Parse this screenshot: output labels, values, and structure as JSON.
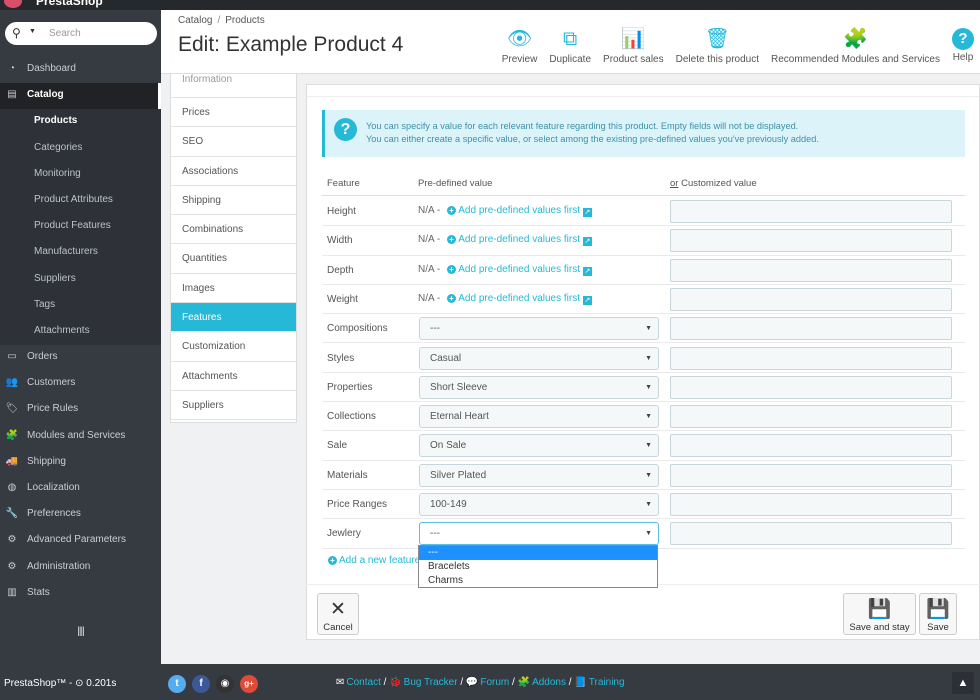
{
  "topbar": {
    "brand": "PrestaShop"
  },
  "sidebar": {
    "search_placeholder": "Search",
    "items": [
      {
        "label": "Dashboard",
        "icon": "dashboard-icon"
      },
      {
        "label": "Catalog",
        "icon": "catalog-icon",
        "active": true
      },
      {
        "label": "Products",
        "sub": true,
        "current": true
      },
      {
        "label": "Categories",
        "sub": true
      },
      {
        "label": "Monitoring",
        "sub": true
      },
      {
        "label": "Product Attributes",
        "sub": true
      },
      {
        "label": "Product Features",
        "sub": true
      },
      {
        "label": "Manufacturers",
        "sub": true
      },
      {
        "label": "Suppliers",
        "sub": true
      },
      {
        "label": "Tags",
        "sub": true
      },
      {
        "label": "Attachments",
        "sub": true
      },
      {
        "label": "Orders",
        "icon": "orders-icon"
      },
      {
        "label": "Customers",
        "icon": "customers-icon"
      },
      {
        "label": "Price Rules",
        "icon": "price-rules-icon"
      },
      {
        "label": "Modules and Services",
        "icon": "modules-icon"
      },
      {
        "label": "Shipping",
        "icon": "truck-icon"
      },
      {
        "label": "Localization",
        "icon": "globe-icon"
      },
      {
        "label": "Preferences",
        "icon": "wrench-icon"
      },
      {
        "label": "Advanced Parameters",
        "icon": "gears-icon"
      },
      {
        "label": "Administration",
        "icon": "gear-icon"
      },
      {
        "label": "Stats",
        "icon": "stats-icon"
      }
    ]
  },
  "header": {
    "breadcrumb": [
      "Catalog",
      "Products"
    ],
    "title": "Edit: Example Product 4",
    "toolbar": [
      {
        "label": "Preview",
        "icon": "eye-icon",
        "glyph": "👁"
      },
      {
        "label": "Duplicate",
        "icon": "duplicate-icon",
        "glyph": "⧉"
      },
      {
        "label": "Product sales",
        "icon": "bar-chart-icon",
        "glyph": "📊"
      },
      {
        "label": "Delete this product",
        "icon": "trash-icon",
        "glyph": "🗑"
      },
      {
        "label": "Recommended Modules and Services",
        "icon": "puzzle-icon",
        "glyph": "🧩"
      },
      {
        "label": "Help",
        "icon": "help-icon",
        "glyph": "?"
      }
    ]
  },
  "tabs": {
    "items": [
      "Information",
      "Prices",
      "SEO",
      "Associations",
      "Shipping",
      "Combinations",
      "Quantities",
      "Images",
      "Features",
      "Customization",
      "Attachments",
      "Suppliers"
    ],
    "active": "Features"
  },
  "features": {
    "alert_line1": "You can specify a value for each relevant feature regarding this product. Empty fields will not be displayed.",
    "alert_line2": "You can either create a specific value, or select among the existing pre-defined values you've previously added.",
    "col_feature": "Feature",
    "col_predefined": "Pre-defined value",
    "col_or": "or",
    "col_custom": "Customized value",
    "na": "N/A -",
    "add_predefined": "Add pre-defined values first",
    "rows": [
      {
        "name": "Height",
        "type": "na"
      },
      {
        "name": "Width",
        "type": "na"
      },
      {
        "name": "Depth",
        "type": "na"
      },
      {
        "name": "Weight",
        "type": "na"
      },
      {
        "name": "Compositions",
        "type": "select",
        "value": "---"
      },
      {
        "name": "Styles",
        "type": "select",
        "value": "Casual"
      },
      {
        "name": "Properties",
        "type": "select",
        "value": "Short Sleeve"
      },
      {
        "name": "Collections",
        "type": "select",
        "value": "Eternal Heart"
      },
      {
        "name": "Sale",
        "type": "select",
        "value": "On Sale"
      },
      {
        "name": "Materials",
        "type": "select",
        "value": "Silver Plated"
      },
      {
        "name": "Price Ranges",
        "type": "select",
        "value": "100-149"
      },
      {
        "name": "Jewlery",
        "type": "select",
        "value": "---",
        "open": true
      }
    ],
    "dropdown_options": [
      "---",
      "Bracelets",
      "Charms"
    ],
    "add_feature": "Add a new feature"
  },
  "buttons": {
    "cancel": "Cancel",
    "save_and_stay": "Save and stay",
    "save": "Save"
  },
  "footer": {
    "version": "PrestaShop™ - ⊙ 0.201s",
    "links": [
      "Contact",
      "Bug Tracker",
      "Forum",
      "Addons",
      "Training"
    ]
  },
  "colors": {
    "accent": "#25b9d7",
    "sidebar": "#363a41",
    "alert_bg": "#dcf4f9"
  }
}
